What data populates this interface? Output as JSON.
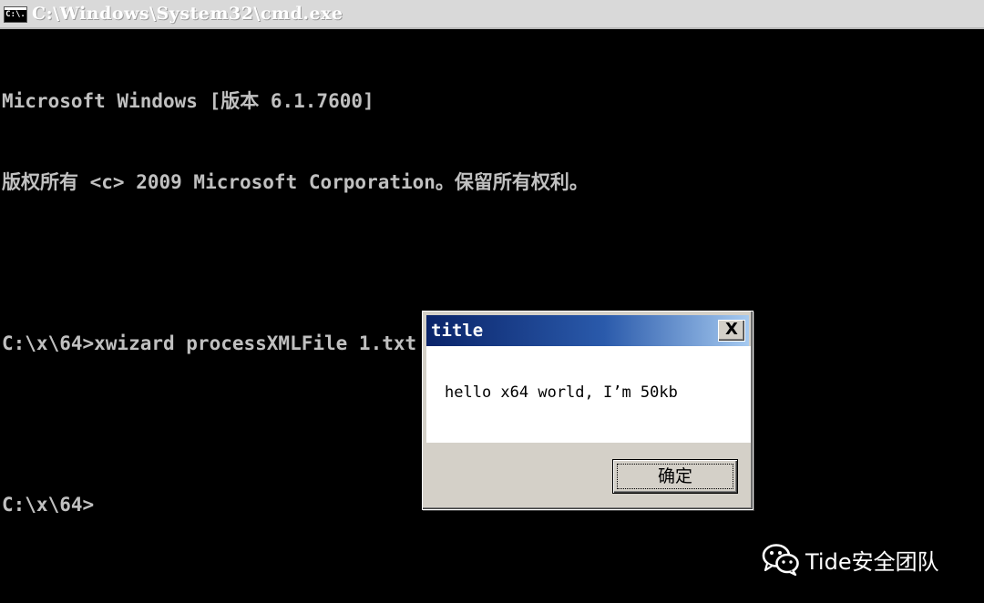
{
  "window": {
    "title": "C:\\Windows\\System32\\cmd.exe",
    "icon_label": "C:\\."
  },
  "console": {
    "lines": [
      "Microsoft Windows [版本 6.1.7600]",
      "版权所有 <c> 2009 Microsoft Corporation。保留所有权利。",
      "",
      "C:\\x\\64>xwizard processXMLFile 1.txt",
      "",
      "C:\\x\\64>"
    ],
    "text_color": "#c0c0c0",
    "background_color": "#000000"
  },
  "dialog": {
    "title": "title",
    "close_label": "X",
    "message": "hello x64 world, I’m 50kb",
    "ok_label": "确定"
  },
  "watermark": {
    "icon": "wechat-icon",
    "text": "Tide安全团队"
  }
}
